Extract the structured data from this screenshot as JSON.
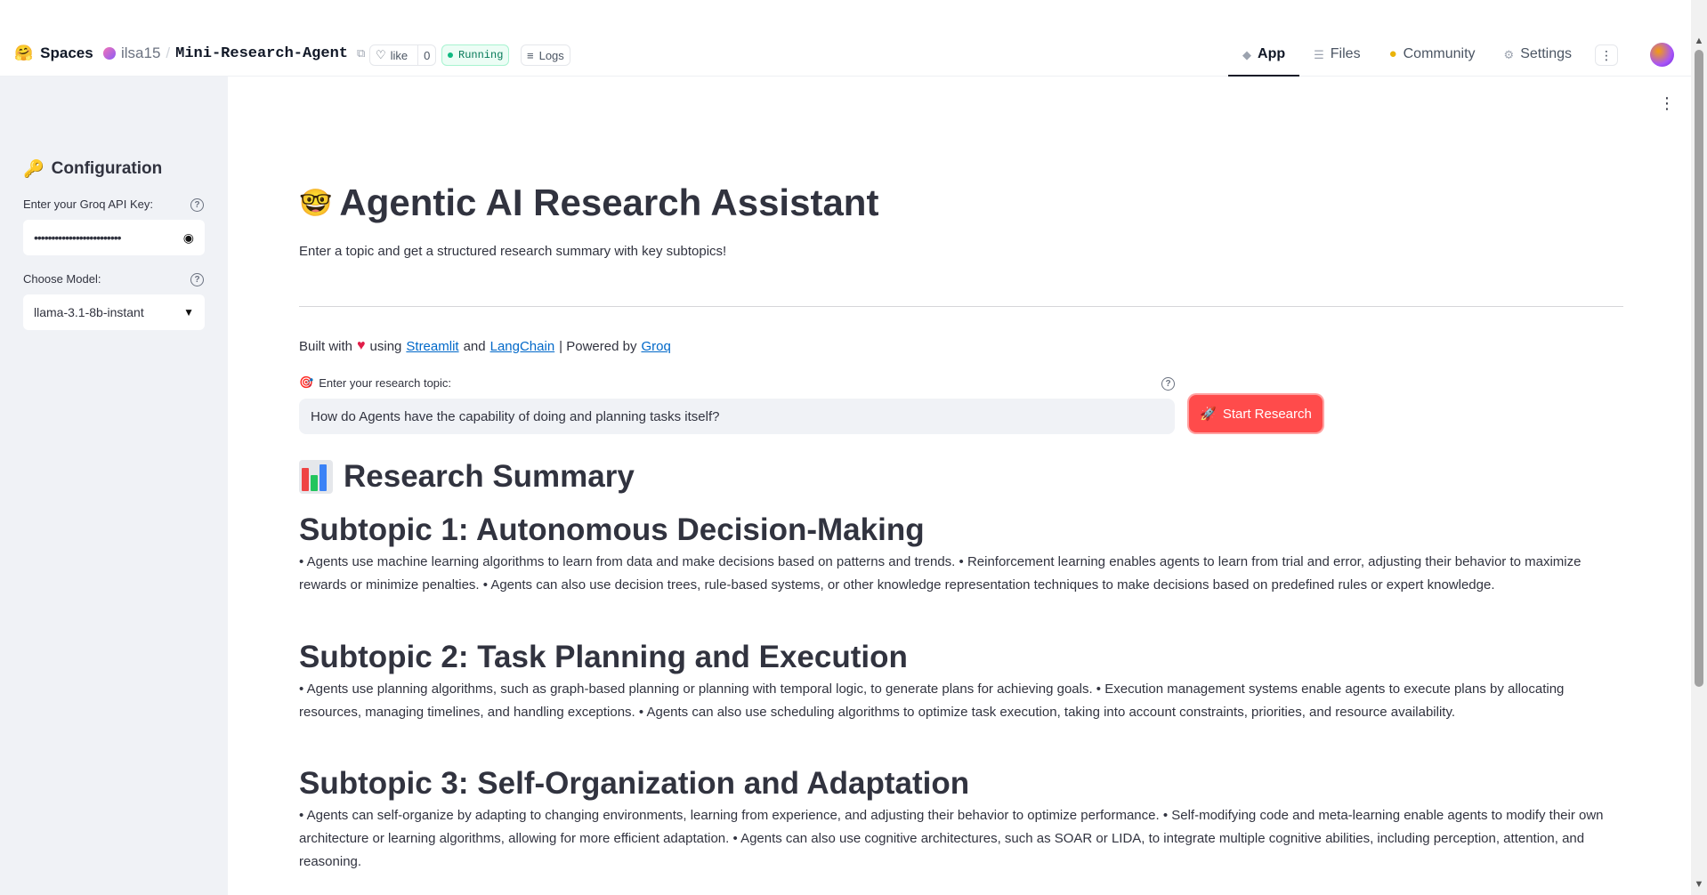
{
  "topbar": {
    "brand": "Spaces",
    "brand_emoji": "🤗",
    "owner": "ilsa15",
    "separator": "/",
    "repo": "Mini-Research-Agent",
    "like_label": "like",
    "like_count": "0",
    "status": "Running",
    "logs_label": "Logs",
    "tabs": [
      {
        "label": "App",
        "icon": "cube-icon"
      },
      {
        "label": "Files",
        "icon": "files-icon"
      },
      {
        "label": "Community",
        "icon": "community-icon"
      },
      {
        "label": "Settings",
        "icon": "gear-icon"
      }
    ]
  },
  "sidebar": {
    "title": "Configuration",
    "title_emoji": "🔑",
    "api_key_label": "Enter your Groq API Key:",
    "api_key_value": "•••••••••••••••••••••••••",
    "model_label": "Choose Model:",
    "model_value": "llama-3.1-8b-instant"
  },
  "main": {
    "title": "Agentic AI Research Assistant",
    "title_emoji": "🤓",
    "subtitle": "Enter a topic and get a structured research summary with key subtopics!",
    "built_prefix": "Built with",
    "built_using": "using",
    "link_streamlit": "Streamlit",
    "built_and": "and",
    "link_langchain": "LangChain",
    "built_powered": "| Powered by",
    "link_groq": "Groq",
    "topic_label": "Enter your research topic:",
    "topic_emoji": "🎯",
    "topic_value": "How do Agents have the capability of doing and planning tasks itself?",
    "start_button": "Start Research",
    "start_emoji": "🚀",
    "summary_title": "Research Summary",
    "subtopics": [
      {
        "heading": "Subtopic 1: Autonomous Decision-Making",
        "text": "• Agents use machine learning algorithms to learn from data and make decisions based on patterns and trends. • Reinforcement learning enables agents to learn from trial and error, adjusting their behavior to maximize rewards or minimize penalties. • Agents can also use decision trees, rule-based systems, or other knowledge representation techniques to make decisions based on predefined rules or expert knowledge."
      },
      {
        "heading": "Subtopic 2: Task Planning and Execution",
        "text": "• Agents use planning algorithms, such as graph-based planning or planning with temporal logic, to generate plans for achieving goals. • Execution management systems enable agents to execute plans by allocating resources, managing timelines, and handling exceptions. • Agents can also use scheduling algorithms to optimize task execution, taking into account constraints, priorities, and resource availability."
      },
      {
        "heading": "Subtopic 3: Self-Organization and Adaptation",
        "text": "• Agents can self-organize by adapting to changing environments, learning from experience, and adjusting their behavior to optimize performance. • Self-modifying code and meta-learning enable agents to modify their own architecture or learning algorithms, allowing for more efficient adaptation. • Agents can also use cognitive architectures, such as SOAR or LIDA, to integrate multiple cognitive abilities, including perception, attention, and reasoning."
      }
    ]
  },
  "colors": {
    "primary": "#ff4b4b",
    "sidebar_bg": "#f0f2f6",
    "link": "#0068c9",
    "running": "#10b981"
  }
}
